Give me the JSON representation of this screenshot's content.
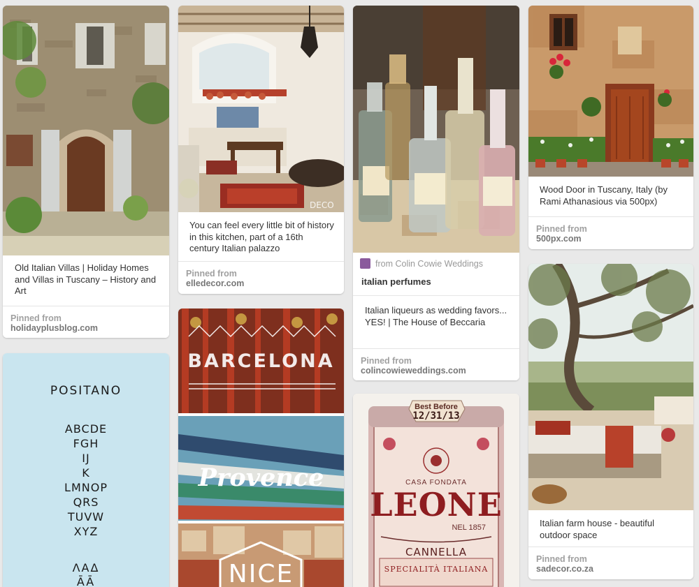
{
  "pins": [
    {
      "id": "villas",
      "image_icon": "tuscan-villa-photo",
      "description": "Old Italian Villas | Holiday Homes and Villas in Tuscany – History and Art",
      "pinned_label": "Pinned from",
      "source": "holidayplusblog.com"
    },
    {
      "id": "positano",
      "image_icon": "font-sample-graphic",
      "font_title": "POSITANO",
      "font_lines": [
        "ABCDE",
        "FGH",
        "IJ",
        "K",
        "LMNOP",
        "QRS",
        "TUVW",
        "XYZ"
      ],
      "font_extra": [
        "ΛΑΔ",
        "ĀĀ"
      ]
    },
    {
      "id": "kitchen",
      "image_icon": "palazzo-kitchen-photo",
      "image_watermark": "DECO",
      "description": "You can feel every little bit of history in this kitchen, part of a 16th century Italian palazzo",
      "pinned_label": "Pinned from",
      "source": "elledecor.com"
    },
    {
      "id": "collage",
      "image_icon": "travel-collage-photo",
      "labels": [
        "BARCELONA",
        "Provence",
        "NICE"
      ]
    },
    {
      "id": "perfumes",
      "image_icon": "perfume-bottles-photo",
      "via_label": "from Colin Cowie Weddings",
      "board_title": "italian perfumes",
      "description": "Italian liqueurs as wedding favors... YES! | The House of Beccaria",
      "pinned_label": "Pinned from",
      "source": "colincowieweddings.com"
    },
    {
      "id": "leone",
      "image_icon": "leone-tin-photo",
      "tag_top": "Best Before",
      "tag_date": "12/31/13",
      "brand_line": "CASA FONDATA",
      "brand": "LEONE",
      "year": "NEL 1857",
      "flavour": "CANNELLA",
      "tagline": "SPECIALITÀ ITALIANA"
    },
    {
      "id": "door",
      "image_icon": "wood-door-photo",
      "description": "Wood Door in Tuscany, Italy (by Rami Athanasious via 500px)",
      "pinned_label": "Pinned from",
      "source": "500px.com"
    },
    {
      "id": "farmhouse",
      "image_icon": "farmhouse-terrace-photo",
      "description": "Italian farm house - beautiful outdoor space",
      "pinned_label": "Pinned from",
      "source": "sadecor.co.za"
    }
  ]
}
